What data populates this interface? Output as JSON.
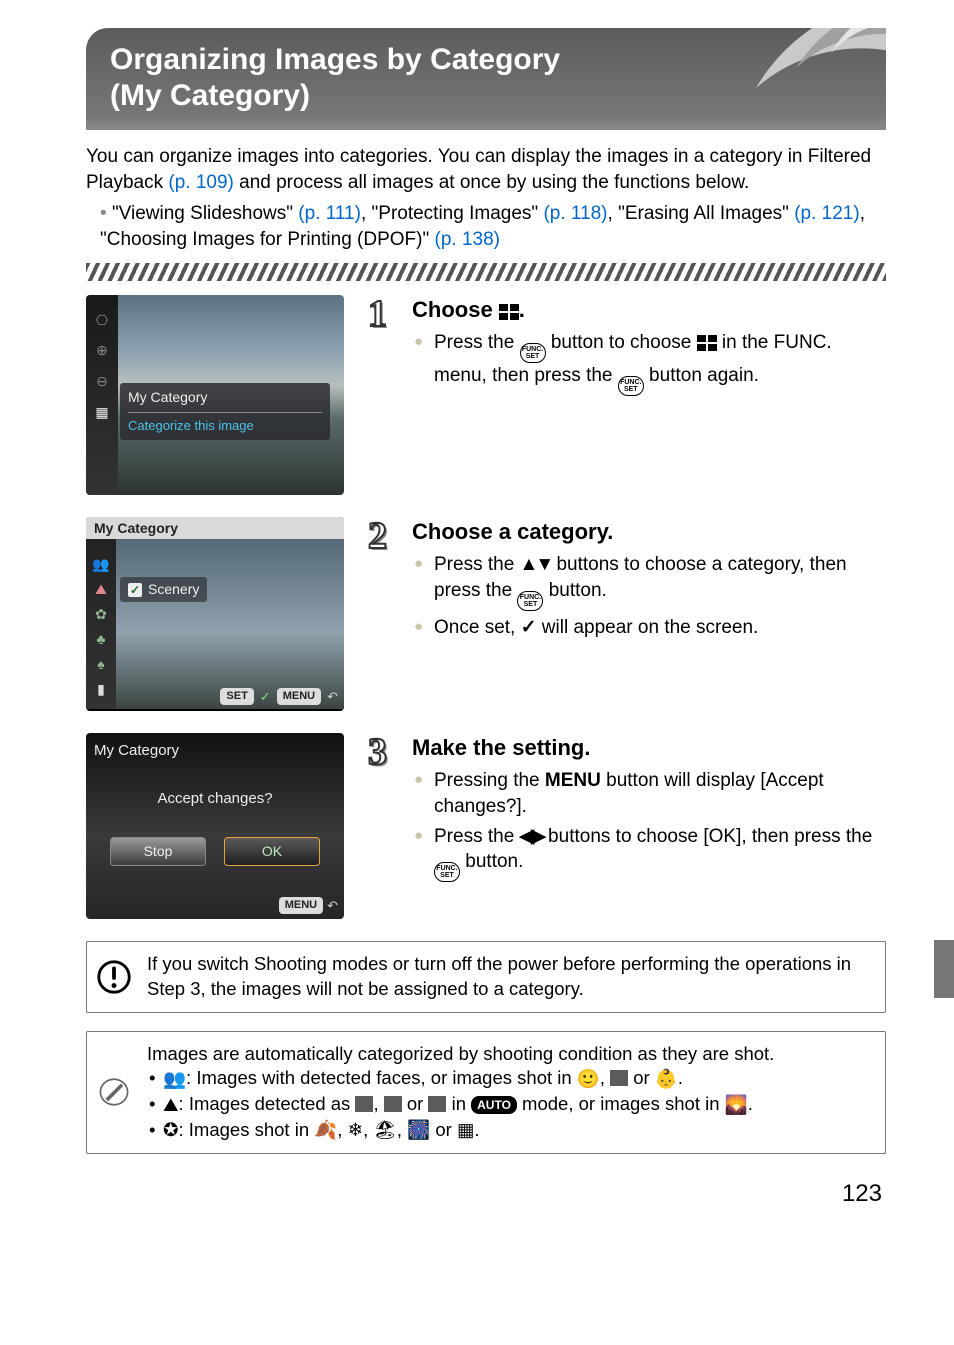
{
  "header": {
    "title_line1": "Organizing Images by Category",
    "title_line2": "(My Category)"
  },
  "intro": {
    "p1_pre": "You can organize images into categories. You can display the images in a category in Filtered Playback ",
    "p1_link": "(p. 109)",
    "p1_post": " and process all images at once by using the functions below."
  },
  "refs": {
    "text": "\"Viewing Slideshows\" (p. 111), \"Protecting Images\" (p. 118), \"Erasing All Images\" (p. 121), \"Choosing Images for Printing (DPOF)\" (p. 138)",
    "parts": [
      {
        "t": "\"Viewing Slideshows\" ",
        "l": false
      },
      {
        "t": "(p. 111)",
        "l": true
      },
      {
        "t": ", \"Protecting Images\" ",
        "l": false
      },
      {
        "t": "(p. 118)",
        "l": true
      },
      {
        "t": ", \"Erasing All Images\" ",
        "l": false
      },
      {
        "t": "(p. 121)",
        "l": true
      },
      {
        "t": ", \"Choosing Images for Printing (DPOF)\" ",
        "l": false
      },
      {
        "t": "(p. 138)",
        "l": true
      }
    ]
  },
  "steps": {
    "s1": {
      "num": "1",
      "title_pre": "Choose ",
      "title_icon": "my-category-icon",
      "title_post": ".",
      "b1a": "Press the ",
      "b1b": " button to choose ",
      "b1c": " in the FUNC. menu, then press the ",
      "b1d": " button again.",
      "thumb": {
        "tooltip_title": "My Category",
        "tooltip_sub": "Categorize this image"
      }
    },
    "s2": {
      "num": "2",
      "title": "Choose a category.",
      "b1a": "Press the ",
      "b1b": " buttons to choose a category, then press the ",
      "b1c": " button.",
      "b2a": "Once set, ",
      "b2b": " will appear on the screen.",
      "thumb": {
        "topbar": "My Category",
        "item": "Scenery",
        "set": "SET",
        "menu": "MENU"
      }
    },
    "s3": {
      "num": "3",
      "title": "Make the setting.",
      "b1a": "Pressing the ",
      "b1b": " button will display [Accept changes?].",
      "b2a": "Press the ",
      "b2b": " buttons to choose [OK], then press the ",
      "b2c": " button.",
      "thumb": {
        "title": "My Category",
        "msg": "Accept changes?",
        "btn_stop": "Stop",
        "btn_ok": "OK",
        "menu": "MENU"
      }
    }
  },
  "note1": "If you switch Shooting modes or turn off the power before performing the operations in Step 3, the images will not be assigned to a category.",
  "note2": {
    "lead": "Images are automatically categorized by shooting condition as they are shot.",
    "li1_a": ": Images with detected faces, or images shot in ",
    "li1_b": ", ",
    "li1_c": " or ",
    "li1_d": ".",
    "li2_a": ": Images detected as ",
    "li2_b": ", ",
    "li2_c": " or ",
    "li2_d": " in ",
    "li2_e": " mode, or images shot in ",
    "li2_f": ".",
    "li3_a": ": Images shot in ",
    "li3_b": ", ",
    "li3_c": ", ",
    "li3_d": ", ",
    "li3_e": " or ",
    "li3_f": ".",
    "auto": "AUTO"
  },
  "pagenum": "123"
}
